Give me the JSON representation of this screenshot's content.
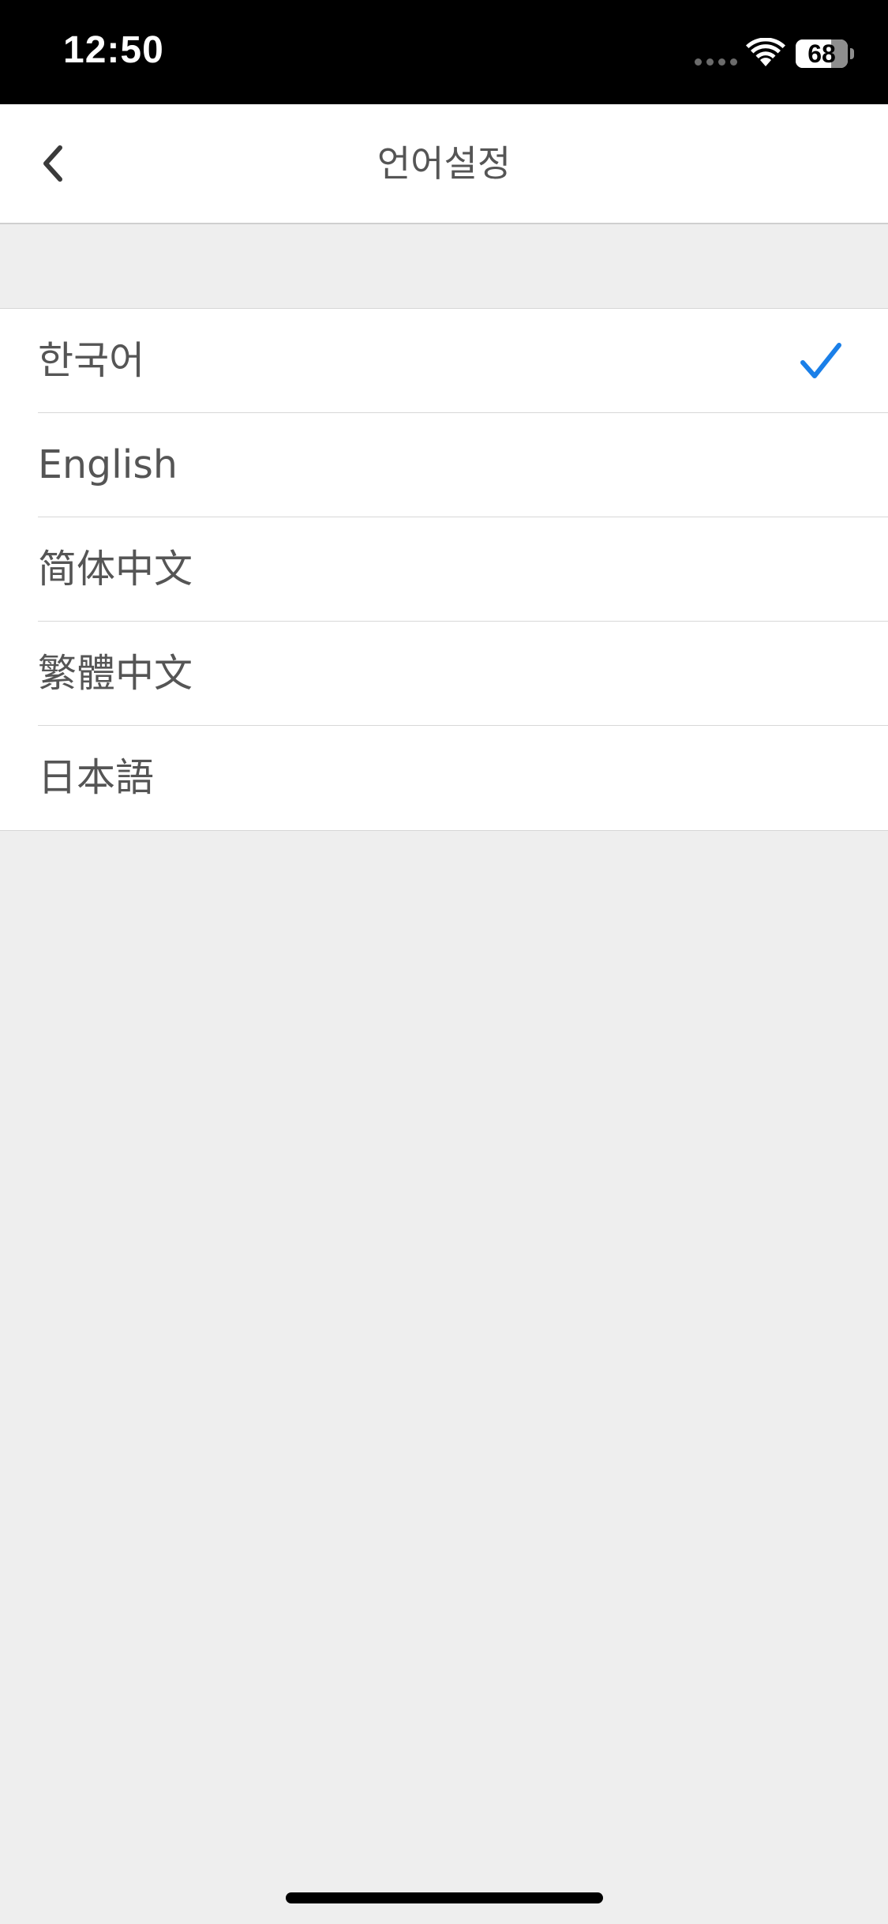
{
  "status_bar": {
    "time": "12:50",
    "battery_percent": "68",
    "battery_level": 0.68,
    "icons": [
      "cellular-signal-icon",
      "wifi-icon",
      "battery-icon"
    ]
  },
  "nav": {
    "title": "언어설정",
    "back_icon": "chevron-left-icon"
  },
  "languages": [
    {
      "label": "한국어",
      "selected": true
    },
    {
      "label": "English",
      "selected": false
    },
    {
      "label": "简体中文",
      "selected": false
    },
    {
      "label": "繁體中文",
      "selected": false
    },
    {
      "label": "日本語",
      "selected": false
    }
  ],
  "colors": {
    "accent": "#1a7fe8",
    "background": "#eeeeee",
    "text": "#555555"
  }
}
